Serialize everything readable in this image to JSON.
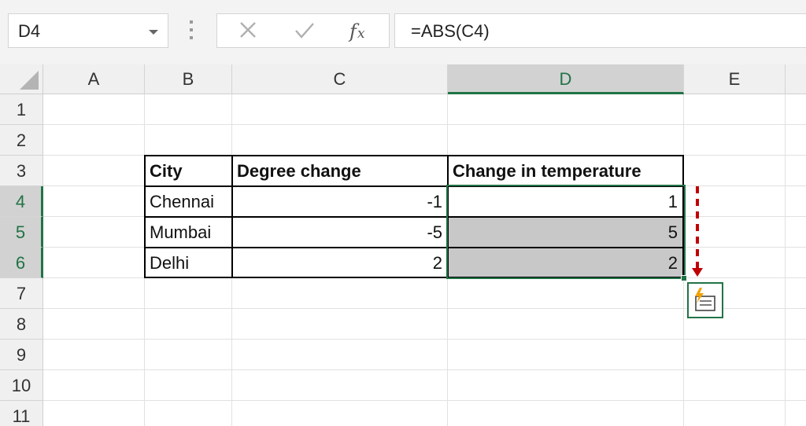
{
  "name_box": {
    "value": "D4"
  },
  "formula_bar": {
    "cancel_icon": "close-icon",
    "enter_icon": "checkmark-icon",
    "function_icon": "fx-icon",
    "formula": "=ABS(C4)"
  },
  "columns": [
    "A",
    "B",
    "C",
    "D",
    "E"
  ],
  "rows": [
    "1",
    "2",
    "3",
    "4",
    "5",
    "6",
    "7",
    "8",
    "9",
    "10",
    "11"
  ],
  "selected_column": "D",
  "selected_rows": [
    "4",
    "5",
    "6"
  ],
  "table": {
    "headers": [
      "City",
      "Degree change",
      "Change in temperature"
    ],
    "rows": [
      {
        "city": "Chennai",
        "degree_change": "-1",
        "change_in_temperature": "1"
      },
      {
        "city": "Mumbai",
        "degree_change": "-5",
        "change_in_temperature": "5"
      },
      {
        "city": "Delhi",
        "degree_change": "2",
        "change_in_temperature": "2"
      }
    ]
  },
  "quick_analysis": {
    "icon": "flash-fill-icon"
  },
  "colors": {
    "accent": "#217346",
    "selection_fill": "#c8c8c8",
    "annotation": "#c00000"
  }
}
